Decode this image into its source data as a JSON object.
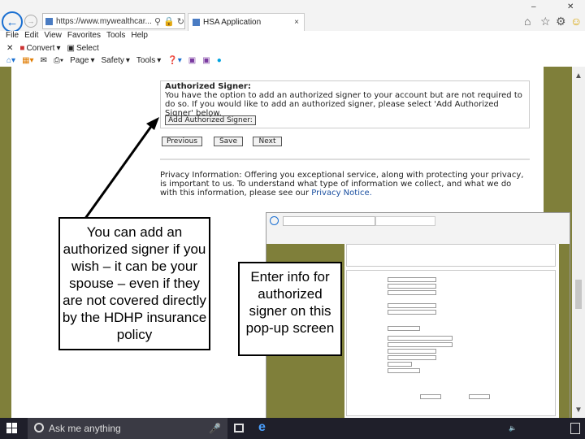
{
  "browser": {
    "url": "https://www.mywealthcar...",
    "tab_title": "HSA Application",
    "tab_close": "×",
    "menu": [
      "File",
      "Edit",
      "View",
      "Favorites",
      "Tools",
      "Help"
    ],
    "cmd1": {
      "convert": "Convert",
      "select": "Select"
    },
    "cmd2": {
      "page": "Page",
      "safety": "Safety",
      "tools": "Tools"
    }
  },
  "page": {
    "signer_heading": "Authorized Signer:",
    "signer_text": "You have the option to add an authorized signer to your account but are not required to do so. If you would like to add an authorized signer, please select 'Add Authorized Signer' below.",
    "add_button": "Add Authorized Signer:",
    "previous_button": "Previous",
    "save_button": "Save",
    "next_button": "Next",
    "privacy_text": "Privacy Information: Offering you exceptional service, along with protecting your privacy, is important to us. To understand what type of information we collect, and what we do with this information, please see our",
    "privacy_link": "Privacy Notice."
  },
  "callouts": {
    "left": "You can add an authorized signer if you wish – it can be your spouse – even if they are not covered directly by the HDHP insurance policy",
    "right": "Enter info for authorized signer on this pop-up screen"
  },
  "taskbar": {
    "search_placeholder": "Ask me anything"
  },
  "colors": {
    "olive_border": "#7f7f3a",
    "taskbar": "#1f1f2a",
    "accent_blue": "#1a6fd1"
  }
}
